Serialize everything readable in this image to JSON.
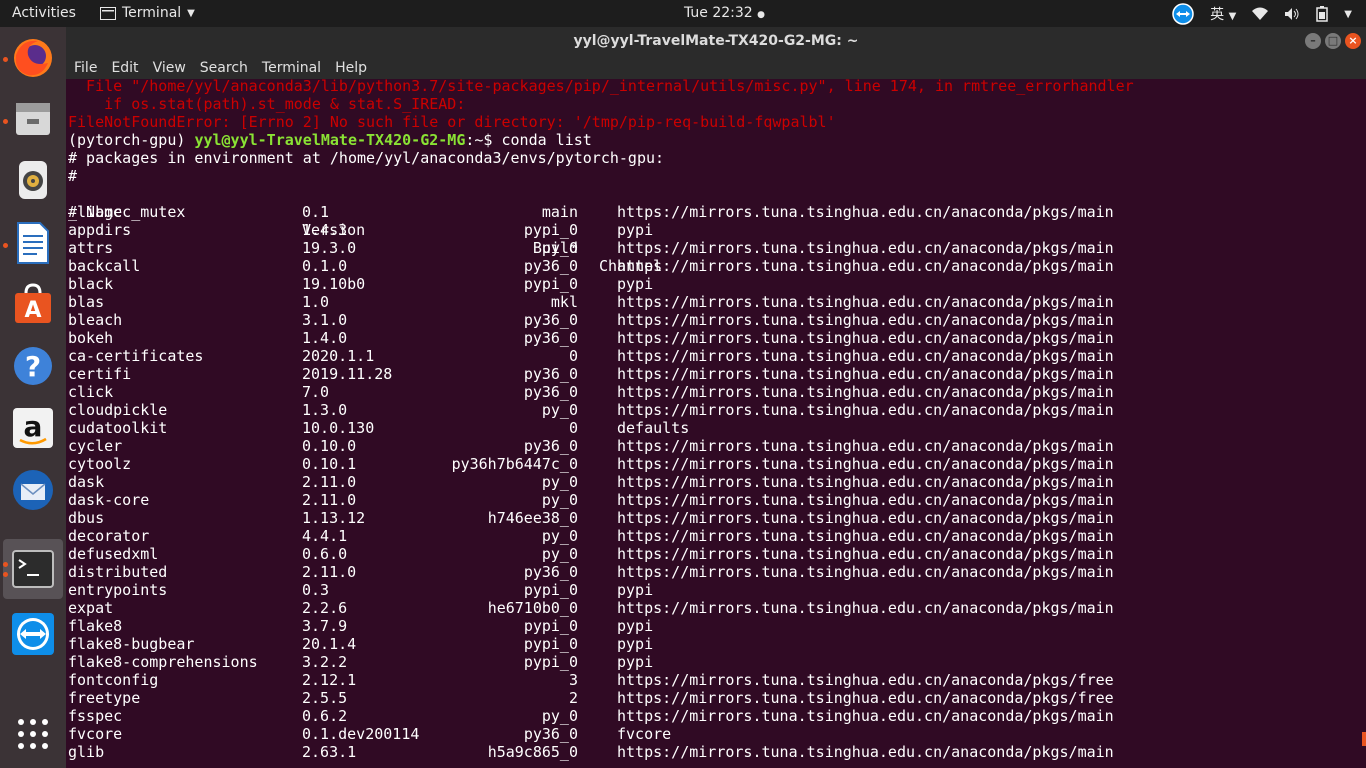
{
  "topbar": {
    "activities": "Activities",
    "app_name": "Terminal",
    "clock": "Tue 22:32",
    "input_method": "英"
  },
  "dock": {
    "items": [
      "firefox-icon",
      "files-icon",
      "rhythmbox-icon",
      "writer-icon",
      "software-icon",
      "help-icon",
      "amazon-icon",
      "thunderbird-icon",
      "terminal-icon",
      "teamviewer-icon",
      "show-apps-icon"
    ]
  },
  "window": {
    "title": "yyl@yyl-TravelMate-TX420-G2-MG: ~",
    "menu": [
      "File",
      "Edit",
      "View",
      "Search",
      "Terminal",
      "Help"
    ]
  },
  "terminal": {
    "error_lines": [
      "  File \"/home/yyl/anaconda3/lib/python3.7/site-packages/pip/_internal/utils/misc.py\", line 174, in rmtree_errorhandler",
      "    if os.stat(path).st_mode & stat.S_IREAD:",
      "FileNotFoundError: [Errno 2] No such file or directory: '/tmp/pip-req-build-fqwpalbl'"
    ],
    "prompt_env": "(pytorch-gpu) ",
    "prompt_user": "yyl@yyl-TravelMate-TX420-G2-MG",
    "prompt_path": ":~$ ",
    "command": "conda list",
    "env_line": "# packages in environment at /home/yyl/anaconda3/envs/pytorch-gpu:",
    "hash_line": "#",
    "header": {
      "name": "# Name",
      "version": "Version",
      "build": "Build",
      "channel": "Channel"
    },
    "packages": [
      [
        "_libgcc_mutex",
        "0.1",
        "main",
        "https://mirrors.tuna.tsinghua.edu.cn/anaconda/pkgs/main"
      ],
      [
        "appdirs",
        "1.4.3",
        "pypi_0",
        "pypi"
      ],
      [
        "attrs",
        "19.3.0",
        "py_0",
        "https://mirrors.tuna.tsinghua.edu.cn/anaconda/pkgs/main"
      ],
      [
        "backcall",
        "0.1.0",
        "py36_0",
        "https://mirrors.tuna.tsinghua.edu.cn/anaconda/pkgs/main"
      ],
      [
        "black",
        "19.10b0",
        "pypi_0",
        "pypi"
      ],
      [
        "blas",
        "1.0",
        "mkl",
        "https://mirrors.tuna.tsinghua.edu.cn/anaconda/pkgs/main"
      ],
      [
        "bleach",
        "3.1.0",
        "py36_0",
        "https://mirrors.tuna.tsinghua.edu.cn/anaconda/pkgs/main"
      ],
      [
        "bokeh",
        "1.4.0",
        "py36_0",
        "https://mirrors.tuna.tsinghua.edu.cn/anaconda/pkgs/main"
      ],
      [
        "ca-certificates",
        "2020.1.1",
        "0",
        "https://mirrors.tuna.tsinghua.edu.cn/anaconda/pkgs/main"
      ],
      [
        "certifi",
        "2019.11.28",
        "py36_0",
        "https://mirrors.tuna.tsinghua.edu.cn/anaconda/pkgs/main"
      ],
      [
        "click",
        "7.0",
        "py36_0",
        "https://mirrors.tuna.tsinghua.edu.cn/anaconda/pkgs/main"
      ],
      [
        "cloudpickle",
        "1.3.0",
        "py_0",
        "https://mirrors.tuna.tsinghua.edu.cn/anaconda/pkgs/main"
      ],
      [
        "cudatoolkit",
        "10.0.130",
        "0",
        "defaults"
      ],
      [
        "cycler",
        "0.10.0",
        "py36_0",
        "https://mirrors.tuna.tsinghua.edu.cn/anaconda/pkgs/main"
      ],
      [
        "cytoolz",
        "0.10.1",
        "py36h7b6447c_0",
        "https://mirrors.tuna.tsinghua.edu.cn/anaconda/pkgs/main"
      ],
      [
        "dask",
        "2.11.0",
        "py_0",
        "https://mirrors.tuna.tsinghua.edu.cn/anaconda/pkgs/main"
      ],
      [
        "dask-core",
        "2.11.0",
        "py_0",
        "https://mirrors.tuna.tsinghua.edu.cn/anaconda/pkgs/main"
      ],
      [
        "dbus",
        "1.13.12",
        "h746ee38_0",
        "https://mirrors.tuna.tsinghua.edu.cn/anaconda/pkgs/main"
      ],
      [
        "decorator",
        "4.4.1",
        "py_0",
        "https://mirrors.tuna.tsinghua.edu.cn/anaconda/pkgs/main"
      ],
      [
        "defusedxml",
        "0.6.0",
        "py_0",
        "https://mirrors.tuna.tsinghua.edu.cn/anaconda/pkgs/main"
      ],
      [
        "distributed",
        "2.11.0",
        "py36_0",
        "https://mirrors.tuna.tsinghua.edu.cn/anaconda/pkgs/main"
      ],
      [
        "entrypoints",
        "0.3",
        "pypi_0",
        "pypi"
      ],
      [
        "expat",
        "2.2.6",
        "he6710b0_0",
        "https://mirrors.tuna.tsinghua.edu.cn/anaconda/pkgs/main"
      ],
      [
        "flake8",
        "3.7.9",
        "pypi_0",
        "pypi"
      ],
      [
        "flake8-bugbear",
        "20.1.4",
        "pypi_0",
        "pypi"
      ],
      [
        "flake8-comprehensions",
        "3.2.2",
        "pypi_0",
        "pypi"
      ],
      [
        "fontconfig",
        "2.12.1",
        "3",
        "https://mirrors.tuna.tsinghua.edu.cn/anaconda/pkgs/free"
      ],
      [
        "freetype",
        "2.5.5",
        "2",
        "https://mirrors.tuna.tsinghua.edu.cn/anaconda/pkgs/free"
      ],
      [
        "fsspec",
        "0.6.2",
        "py_0",
        "https://mirrors.tuna.tsinghua.edu.cn/anaconda/pkgs/main"
      ],
      [
        "fvcore",
        "0.1.dev200114",
        "py36_0",
        "fvcore"
      ],
      [
        "glib",
        "2.63.1",
        "h5a9c865_0",
        "https://mirrors.tuna.tsinghua.edu.cn/anaconda/pkgs/main"
      ]
    ]
  }
}
